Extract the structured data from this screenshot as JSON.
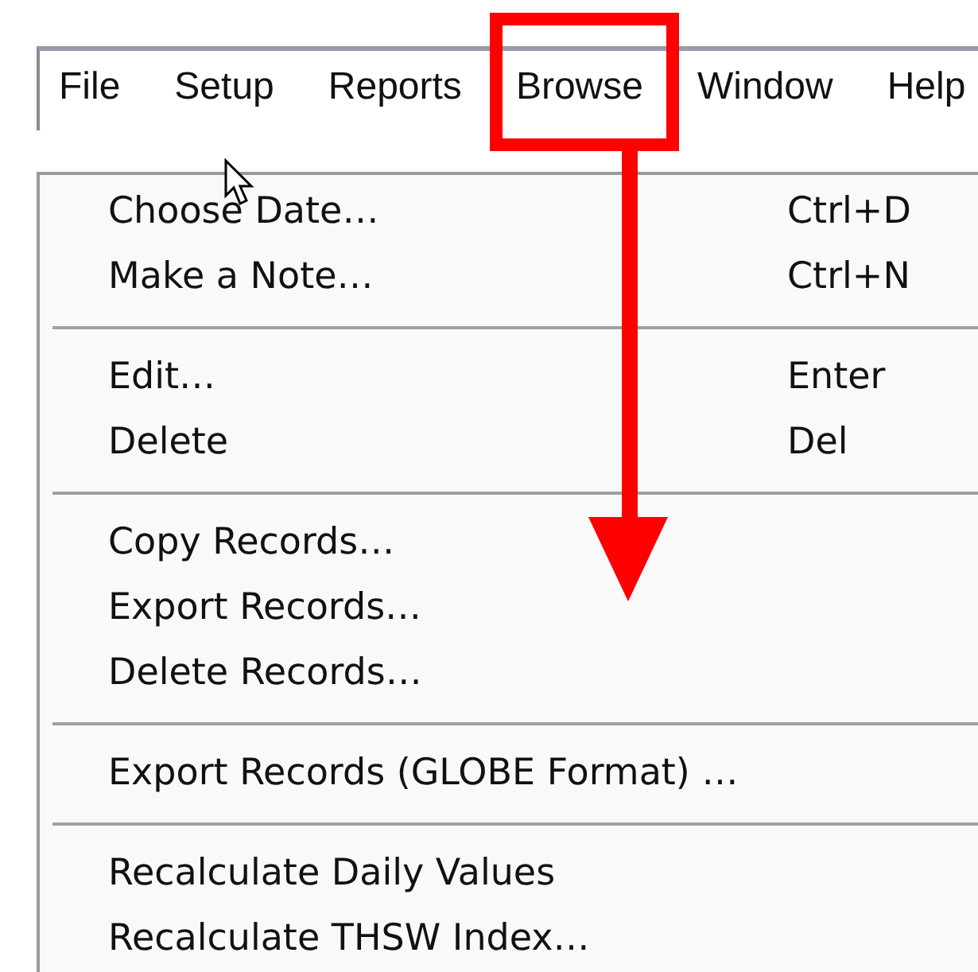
{
  "menubar": [
    {
      "label": "File"
    },
    {
      "label": "Setup"
    },
    {
      "label": "Reports"
    },
    {
      "label": "Browse"
    },
    {
      "label": "Window"
    },
    {
      "label": "Help"
    }
  ],
  "menu": {
    "groups": [
      [
        {
          "label": "Choose Date…",
          "shortcut": "Ctrl+D"
        },
        {
          "label": "Make a Note…",
          "shortcut": "Ctrl+N"
        }
      ],
      [
        {
          "label": "Edit…",
          "shortcut": "Enter"
        },
        {
          "label": "Delete",
          "shortcut": "Del"
        }
      ],
      [
        {
          "label": "Copy Records…"
        },
        {
          "label": "Export Records…"
        },
        {
          "label": "Delete Records…"
        }
      ],
      [
        {
          "label": "Export Records (GLOBE Format) …"
        }
      ],
      [
        {
          "label": "Recalculate Daily Values"
        },
        {
          "label": "Recalculate THSW Index…"
        }
      ]
    ]
  }
}
